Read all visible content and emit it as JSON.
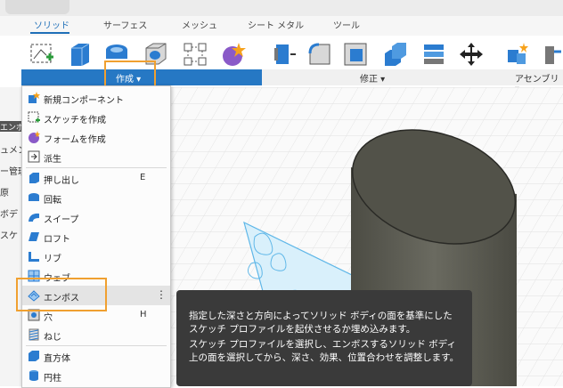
{
  "ribbon": {
    "tabs": [
      {
        "label": "ソリッド"
      },
      {
        "label": "サーフェス"
      },
      {
        "label": "メッシュ"
      },
      {
        "label": "シート メタル"
      },
      {
        "label": "ツール"
      }
    ],
    "active_tab": "ソリッド",
    "sections": {
      "create": "作成 ▾",
      "modify": "修正 ▾",
      "assemble": "アセンブリ ▾"
    }
  },
  "left_panel": {
    "items": [
      "エンボ",
      "ュメン",
      "ー管理",
      "原",
      "ボデ",
      "スケ"
    ]
  },
  "menu": {
    "items": [
      {
        "label": "新規コンポーネント",
        "shortcut": "",
        "icon": "new-component-icon"
      },
      {
        "label": "スケッチを作成",
        "shortcut": "",
        "icon": "sketch-icon"
      },
      {
        "label": "フォームを作成",
        "shortcut": "",
        "icon": "form-icon"
      },
      {
        "label": "派生",
        "shortcut": "",
        "icon": "derive-icon"
      },
      {
        "label": "押し出し",
        "shortcut": "E",
        "icon": "extrude-icon"
      },
      {
        "label": "回転",
        "shortcut": "",
        "icon": "revolve-icon"
      },
      {
        "label": "スイープ",
        "shortcut": "",
        "icon": "sweep-icon"
      },
      {
        "label": "ロフト",
        "shortcut": "",
        "icon": "loft-icon"
      },
      {
        "label": "リブ",
        "shortcut": "",
        "icon": "rib-icon"
      },
      {
        "label": "ウェブ",
        "shortcut": "",
        "icon": "web-icon"
      },
      {
        "label": "エンボス",
        "shortcut": "",
        "icon": "emboss-icon"
      },
      {
        "label": "穴",
        "shortcut": "H",
        "icon": "hole-icon"
      },
      {
        "label": "ねじ",
        "shortcut": "",
        "icon": "thread-icon"
      },
      {
        "label": "直方体",
        "shortcut": "",
        "icon": "box-icon"
      },
      {
        "label": "円柱",
        "shortcut": "",
        "icon": "cylinder-icon"
      }
    ],
    "more": "⋮"
  },
  "tooltip": {
    "p1": "指定した深さと方向によってソリッド ボディの面を基準にしたスケッチ プロファイルを起伏させるか埋め込みます。",
    "p2": "スケッチ プロファイルを選択し、エンボスするソリッド ボディ上の面を選択してから、深さ、効果、位置合わせを調整します。"
  },
  "colors": {
    "accent": "#2678c4",
    "highlight": "#f0a030",
    "tooltip_bg": "#3a3a3a",
    "cylinder": "#5a5a52",
    "sketch_lines": "#5fb7e8"
  }
}
